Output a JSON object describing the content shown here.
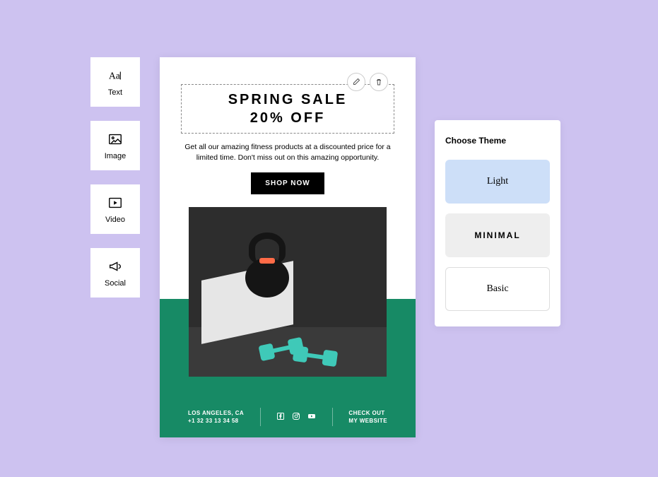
{
  "sidebar": {
    "tools": [
      {
        "label": "Text",
        "icon": "text-icon"
      },
      {
        "label": "Image",
        "icon": "image-icon"
      },
      {
        "label": "Video",
        "icon": "video-icon"
      },
      {
        "label": "Social",
        "icon": "social-icon"
      }
    ]
  },
  "email": {
    "heading_line1": "SPRING SALE",
    "heading_line2": "20% OFF",
    "subheading": "Get all our amazing fitness products at a discounted price for a limited time. Don't miss out on this amazing opportunity.",
    "cta_label": "SHOP NOW",
    "footer": {
      "location": "LOS ANGELES, CA",
      "phone": "+1 32 33 13 34 58",
      "cta_line1": "CHECK OUT",
      "cta_line2": "MY WEBSITE"
    }
  },
  "theme_panel": {
    "title": "Choose Theme",
    "options": [
      {
        "label": "Light"
      },
      {
        "label": "MINIMAL"
      },
      {
        "label": "Basic"
      }
    ]
  }
}
